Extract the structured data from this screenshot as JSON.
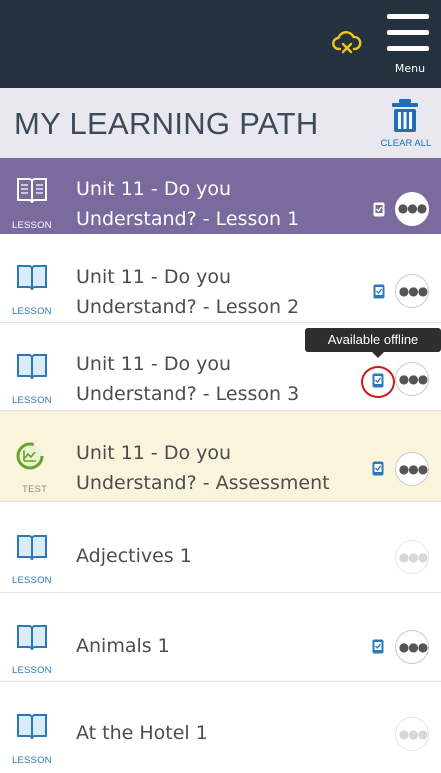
{
  "header": {
    "menu_label": "Menu",
    "cloud_icon": "cloud-download-icon",
    "menu_icon": "hamburger-icon"
  },
  "title_bar": {
    "title": "MY LEARNING PATH",
    "clear_all_label": "CLEAR ALL",
    "clear_all_icon": "trash-icon"
  },
  "tooltip": "Available offline",
  "colors": {
    "header_bg": "#24313f",
    "active_row_bg": "#7b6a9e",
    "test_row_bg": "#fbf4dd",
    "accent_blue": "#2a78b8",
    "highlight_red": "#cc1a1a"
  },
  "items": [
    {
      "kind": "LESSON",
      "line1": "Unit 11 - Do you",
      "line2": "Understand? - Lesson 1",
      "offline": true,
      "state": "active",
      "icon": "book-icon"
    },
    {
      "kind": "LESSON",
      "line1": "Unit 11 - Do you",
      "line2": "Understand? - Lesson 2",
      "offline": true,
      "state": "normal",
      "icon": "book-icon"
    },
    {
      "kind": "LESSON",
      "line1": "Unit 11 - Do you",
      "line2": "Understand? - Lesson 3",
      "offline": true,
      "state": "normal",
      "icon": "book-icon"
    },
    {
      "kind": "TEST",
      "line1": "Unit 11 - Do you",
      "line2": "Understand? - Assessment",
      "offline": true,
      "state": "test",
      "icon": "chart-icon"
    },
    {
      "kind": "LESSON",
      "line1": "Adjectives 1",
      "line2": "",
      "offline": false,
      "state": "normal",
      "icon": "book-icon"
    },
    {
      "kind": "LESSON",
      "line1": "Animals 1",
      "line2": "",
      "offline": true,
      "state": "normal",
      "icon": "book-icon"
    },
    {
      "kind": "LESSON",
      "line1": "At the Hotel 1",
      "line2": "",
      "offline": false,
      "state": "normal",
      "icon": "book-icon"
    }
  ]
}
